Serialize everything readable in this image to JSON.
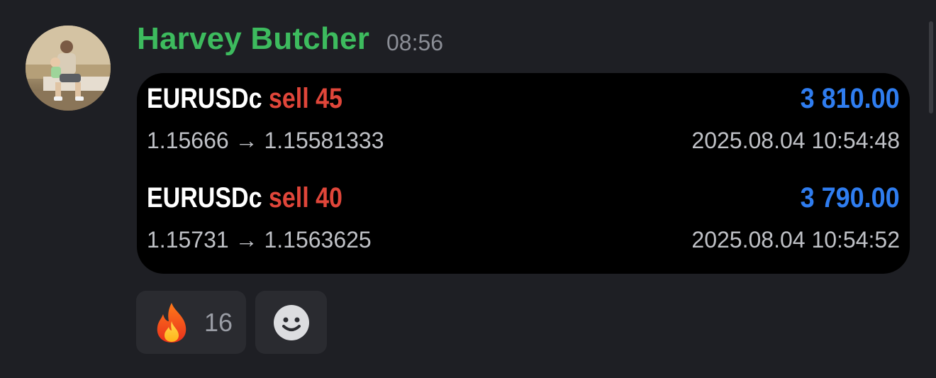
{
  "message": {
    "author": "Harvey Butcher",
    "time": "08:56",
    "trades": [
      {
        "symbol": "EURUSDc",
        "side": "sell",
        "volume": "45",
        "profit": "3 810.00",
        "prices": "1.15666 → 1.15581333",
        "datetime": "2025.08.04 10:54:48"
      },
      {
        "symbol": "EURUSDc",
        "side": "sell",
        "volume": "40",
        "profit": "3 790.00",
        "prices": "1.15731 → 1.1563625",
        "datetime": "2025.08.04 10:54:52"
      }
    ]
  },
  "reactions": [
    {
      "icon": "fire-icon",
      "count": "16"
    },
    {
      "icon": "add-reaction-smiley-icon"
    }
  ],
  "colors": {
    "author": "#3dbb5e",
    "sell": "#e0463a",
    "profit": "#2f7df0",
    "background": "#1e1f24"
  }
}
